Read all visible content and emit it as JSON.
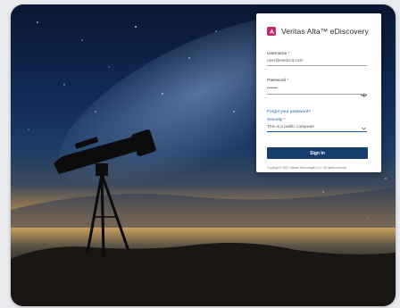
{
  "brand": {
    "name": "Veritas Alta™ eDiscovery"
  },
  "form": {
    "username_label": "Username",
    "username_value": "user@evidxcit.com",
    "password_label": "Password",
    "password_value": "•••••••",
    "forgot_link": "Forgot your password?",
    "security_label": "Security",
    "security_value": "This is a public computer",
    "required_mark": "*",
    "signin_label": "Sign In"
  },
  "footer": {
    "copyright": "Copyright © 2021 Veritas Technologies LLC. All rights reserved."
  },
  "colors": {
    "accent": "#c8256a",
    "button": "#153e6d",
    "link": "#1b5fa8"
  },
  "icons": {
    "logo": "veritas-logo-icon",
    "eye": "eye-icon",
    "dropdown": "chevron-down-icon"
  }
}
